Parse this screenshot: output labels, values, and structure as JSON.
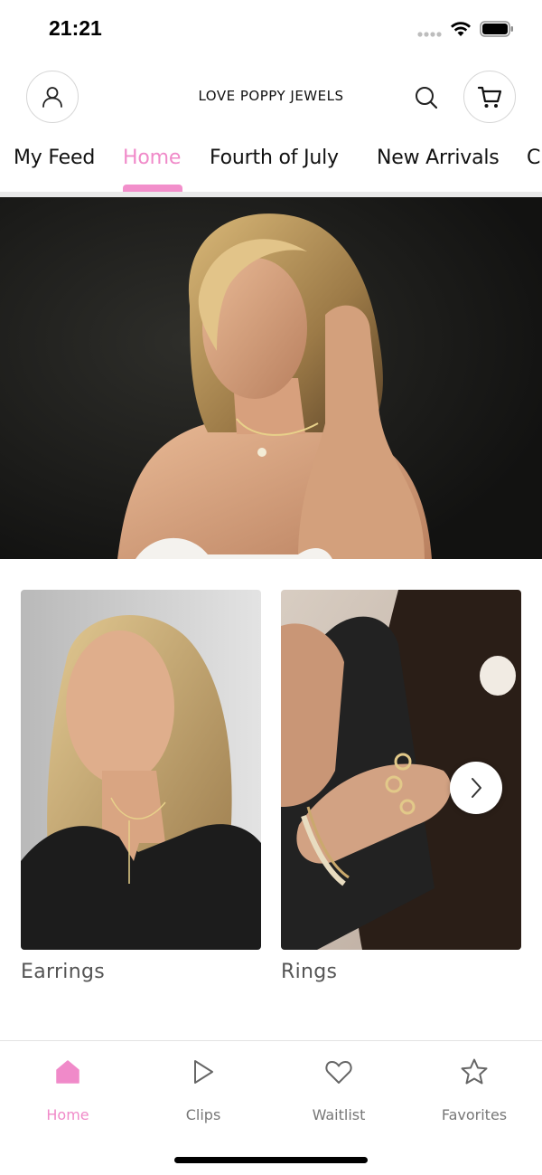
{
  "status_bar": {
    "time": "21:21"
  },
  "header": {
    "brand": "LOVE POPPY JEWELS",
    "icons": [
      "person-icon",
      "search-icon",
      "cart-icon"
    ]
  },
  "tabs": [
    {
      "label": "My Feed",
      "active": false
    },
    {
      "label": "Home",
      "active": true
    },
    {
      "label": "Fourth of July",
      "active": false
    },
    {
      "label": "New Arrivals",
      "active": false
    },
    {
      "label": "C",
      "active": false
    }
  ],
  "categories": [
    {
      "label": "Earrings"
    },
    {
      "label": "Rings"
    }
  ],
  "bottom_nav": [
    {
      "label": "Home",
      "icon": "home-icon",
      "active": true
    },
    {
      "label": "Clips",
      "icon": "play-icon",
      "active": false
    },
    {
      "label": "Waitlist",
      "icon": "heart-icon",
      "active": false
    },
    {
      "label": "Favorites",
      "icon": "star-icon",
      "active": false
    }
  ],
  "colors": {
    "accent": "#f08ac9",
    "text": "#111111",
    "muted": "#777777"
  }
}
